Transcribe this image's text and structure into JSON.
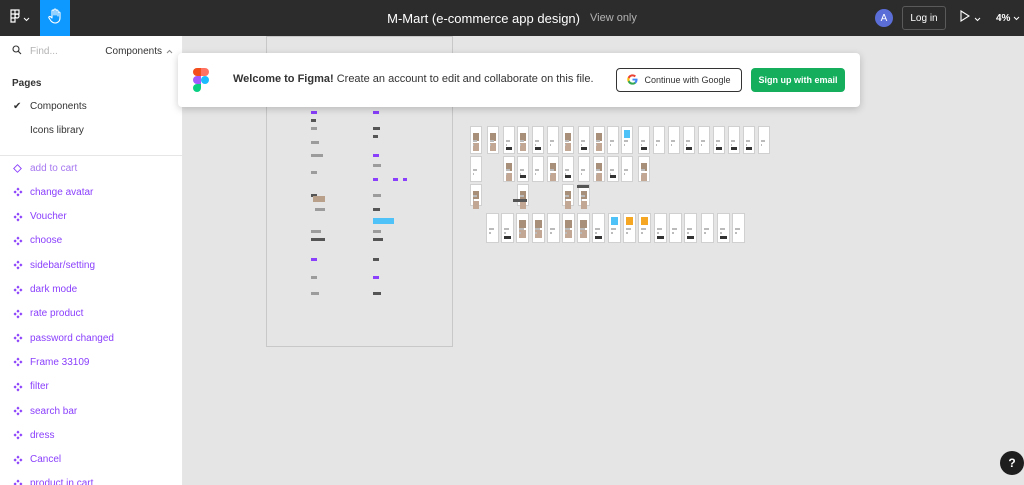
{
  "toolbar": {
    "title": "M-Mart (e-commerce app design)",
    "view_mode": "View only",
    "avatar_initial": "A",
    "login_label": "Log in",
    "zoom": "4%",
    "accent": "#0d99ff"
  },
  "sidebar": {
    "search_placeholder": "Find...",
    "current_page_selector": "Components",
    "pages_heading": "Pages",
    "pages": [
      {
        "label": "Components",
        "selected": true
      },
      {
        "label": "Icons library",
        "selected": false
      }
    ],
    "layers": [
      {
        "label": "add to cart",
        "icon": "component-outline-icon"
      },
      {
        "label": "change avatar",
        "icon": "component-icon"
      },
      {
        "label": "Voucher",
        "icon": "component-icon"
      },
      {
        "label": "choose",
        "icon": "component-icon"
      },
      {
        "label": "sidebar/setting",
        "icon": "component-icon"
      },
      {
        "label": "dark mode",
        "icon": "component-icon"
      },
      {
        "label": "rate product",
        "icon": "component-icon"
      },
      {
        "label": "password changed",
        "icon": "component-icon"
      },
      {
        "label": "Frame 33109",
        "icon": "component-icon"
      },
      {
        "label": "filter",
        "icon": "component-icon"
      },
      {
        "label": "search bar",
        "icon": "component-icon"
      },
      {
        "label": "dress",
        "icon": "component-icon"
      },
      {
        "label": "Cancel",
        "icon": "component-icon"
      },
      {
        "label": "product in cart",
        "icon": "component-icon"
      }
    ],
    "component_color": "#8a3ffc"
  },
  "banner": {
    "welcome_bold": "Welcome to Figma!",
    "welcome_rest": " Create an account to edit and collaborate on this file.",
    "google_label": "Continue with Google",
    "signup_label": "Sign up with email",
    "signup_color": "#14ae5c"
  },
  "help_label": "?"
}
